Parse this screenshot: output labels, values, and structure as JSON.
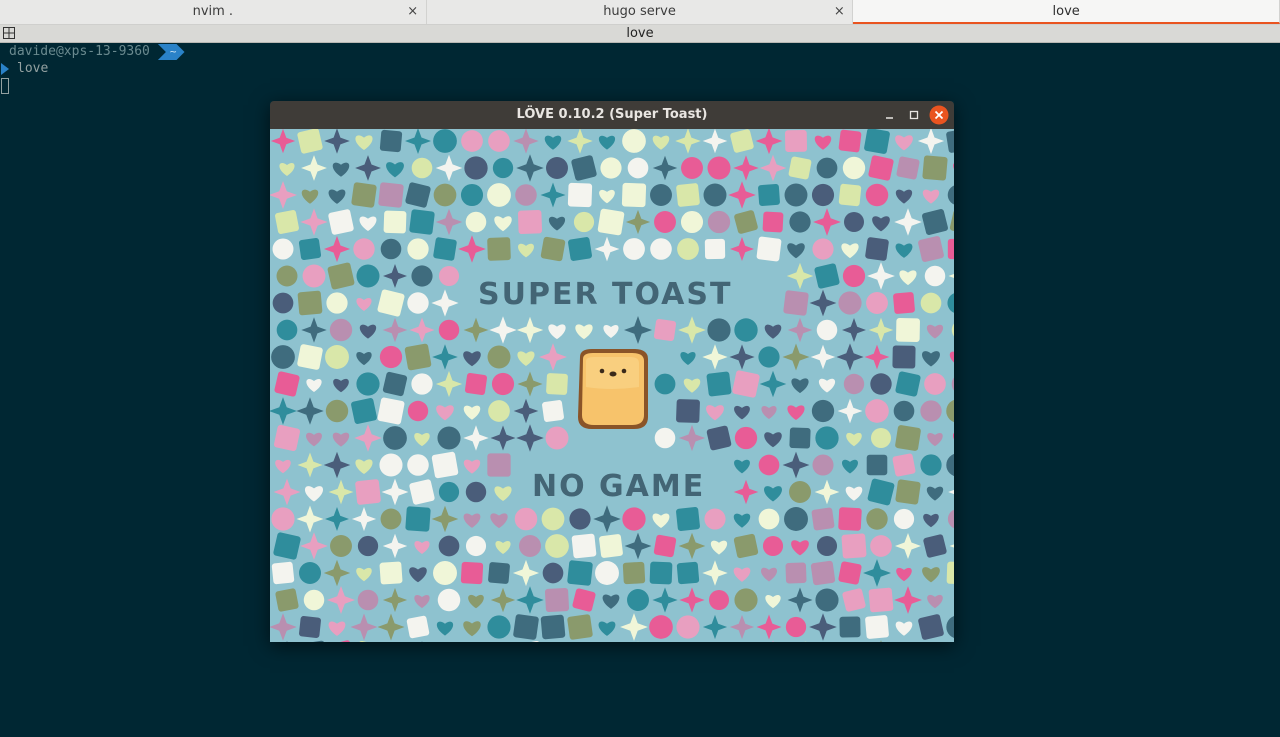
{
  "tabs": [
    {
      "label": "nvim .",
      "closable": true
    },
    {
      "label": "hugo serve",
      "closable": true
    },
    {
      "label": "love",
      "closable": false,
      "active": true
    }
  ],
  "terminal": {
    "title": "love",
    "prompt_user": "davide@xps-13-9360",
    "prompt_dir": "~",
    "command": "love"
  },
  "love_window": {
    "title": "LÖVE 0.10.2 (Super Toast)",
    "close_color": "#e95420",
    "game_word_1": "SUPER TOAST",
    "game_word_2": "NO GAME"
  },
  "colors": {
    "terminal_bg": "#002733",
    "prompt_accent": "#2a82c8",
    "canvas_bg": "#8ec2cf",
    "shape_palette": [
      "#3f6c7e",
      "#2f8d9c",
      "#d9e7a9",
      "#f0f6d8",
      "#e85c96",
      "#b98fb0",
      "#8a9a6c",
      "#f4f4ef",
      "#4a5d7a",
      "#e89fc0"
    ]
  },
  "icons": {
    "terminal_grid": "split-grid-icon",
    "minimize": "minimize-icon",
    "maximize": "maximize-icon",
    "close": "close-icon",
    "toast": "toast-character-icon"
  }
}
